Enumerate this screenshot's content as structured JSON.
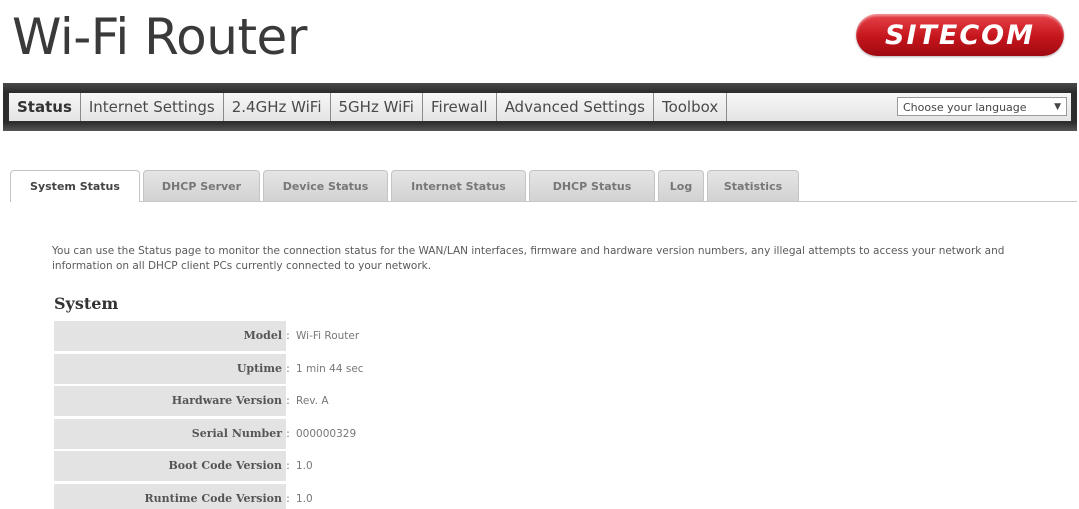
{
  "header": {
    "title": "Wi-Fi Router",
    "brand": "SITECOM"
  },
  "nav": {
    "items": [
      {
        "label": "Status",
        "active": true
      },
      {
        "label": "Internet Settings",
        "active": false
      },
      {
        "label": "2.4GHz WiFi",
        "active": false
      },
      {
        "label": "5GHz WiFi",
        "active": false
      },
      {
        "label": "Firewall",
        "active": false
      },
      {
        "label": "Advanced Settings",
        "active": false
      },
      {
        "label": "Toolbox",
        "active": false
      }
    ],
    "language_select": {
      "value": "Choose your language"
    }
  },
  "tabs": [
    {
      "label": "System Status",
      "active": true
    },
    {
      "label": "DHCP Server",
      "active": false
    },
    {
      "label": "Device Status",
      "active": false
    },
    {
      "label": "Internet Status",
      "active": false
    },
    {
      "label": "DHCP Status",
      "active": false
    },
    {
      "label": "Log",
      "active": false
    },
    {
      "label": "Statistics",
      "active": false
    }
  ],
  "content": {
    "intro": "You can use the Status page to monitor the connection status for the WAN/LAN interfaces, firmware and hardware version numbers, any illegal attempts to access your network and information on all DHCP client PCs currently connected to your network.",
    "section_title": "System",
    "rows": [
      {
        "label": "Model",
        "value": "Wi-Fi Router"
      },
      {
        "label": "Uptime",
        "value": "1 min 44 sec"
      },
      {
        "label": "Hardware Version",
        "value": "Rev. A"
      },
      {
        "label": "Serial Number",
        "value": "000000329"
      },
      {
        "label": "Boot Code Version",
        "value": "1.0"
      },
      {
        "label": "Runtime Code Version",
        "value": "1.0"
      }
    ],
    "separator": ":"
  },
  "colors": {
    "brand_red": "#c5141c",
    "navbar_dark": "#2e2e2e",
    "label_bg": "#e3e3e3"
  }
}
